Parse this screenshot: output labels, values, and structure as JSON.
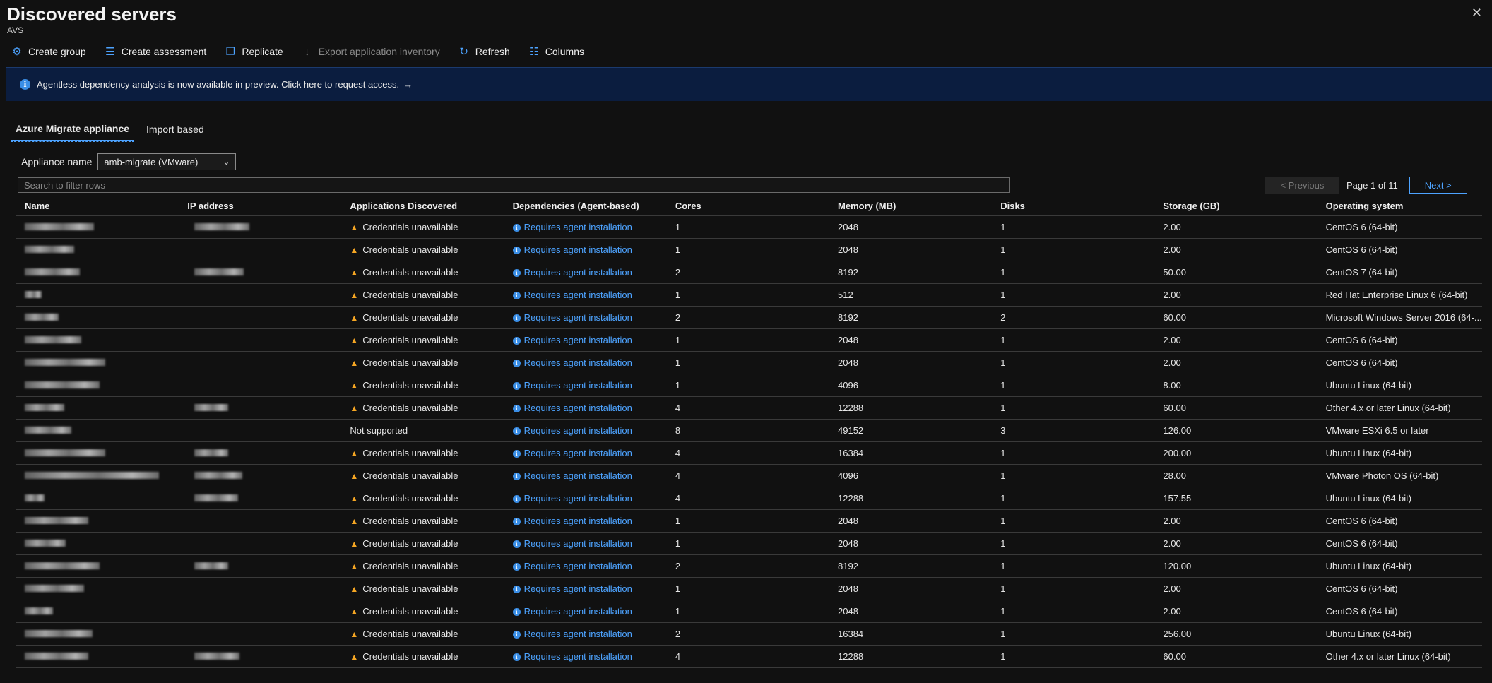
{
  "header": {
    "title": "Discovered servers",
    "subtitle": "AVS",
    "close_icon": "close-icon"
  },
  "toolbar": {
    "create_group": "Create group",
    "create_assessment": "Create assessment",
    "replicate": "Replicate",
    "export": "Export application inventory",
    "refresh": "Refresh",
    "columns": "Columns"
  },
  "banner": {
    "text": "Agentless dependency analysis is now available in preview. Click here to request access.",
    "arrow": "→"
  },
  "tabs": {
    "tab1": "Azure Migrate appliance",
    "tab2": "Import based"
  },
  "appliance": {
    "label": "Appliance name",
    "value": "amb-migrate (VMware)"
  },
  "search": {
    "placeholder": "Search to filter rows"
  },
  "pager": {
    "prev": "< Previous",
    "page": "Page 1 of 11",
    "next": "Next >"
  },
  "table": {
    "headers": [
      "Name",
      "IP address",
      "Applications Discovered",
      "Dependencies (Agent-based)",
      "Cores",
      "Memory (MB)",
      "Disks",
      "Storage (GB)",
      "Operating system"
    ],
    "rows": [
      {
        "app": "Credentials unavailable",
        "dep": "Requires agent installation",
        "cores": "1",
        "mem": "2048",
        "disks": "1",
        "storage": "2.00",
        "os": "CentOS 6 (64-bit)"
      },
      {
        "app": "Credentials unavailable",
        "dep": "Requires agent installation",
        "cores": "1",
        "mem": "2048",
        "disks": "1",
        "storage": "2.00",
        "os": "CentOS 6 (64-bit)"
      },
      {
        "app": "Credentials unavailable",
        "dep": "Requires agent installation",
        "cores": "2",
        "mem": "8192",
        "disks": "1",
        "storage": "50.00",
        "os": "CentOS 7 (64-bit)"
      },
      {
        "app": "Credentials unavailable",
        "dep": "Requires agent installation",
        "cores": "1",
        "mem": "512",
        "disks": "1",
        "storage": "2.00",
        "os": "Red Hat Enterprise Linux 6 (64-bit)"
      },
      {
        "app": "Credentials unavailable",
        "dep": "Requires agent installation",
        "cores": "2",
        "mem": "8192",
        "disks": "2",
        "storage": "60.00",
        "os": "Microsoft Windows Server 2016 (64-..."
      },
      {
        "app": "Credentials unavailable",
        "dep": "Requires agent installation",
        "cores": "1",
        "mem": "2048",
        "disks": "1",
        "storage": "2.00",
        "os": "CentOS 6 (64-bit)"
      },
      {
        "app": "Credentials unavailable",
        "dep": "Requires agent installation",
        "cores": "1",
        "mem": "2048",
        "disks": "1",
        "storage": "2.00",
        "os": "CentOS 6 (64-bit)"
      },
      {
        "app": "Credentials unavailable",
        "dep": "Requires agent installation",
        "cores": "1",
        "mem": "4096",
        "disks": "1",
        "storage": "8.00",
        "os": "Ubuntu Linux (64-bit)"
      },
      {
        "app": "Credentials unavailable",
        "dep": "Requires agent installation",
        "cores": "4",
        "mem": "12288",
        "disks": "1",
        "storage": "60.00",
        "os": "Other 4.x or later Linux (64-bit)"
      },
      {
        "app": "Not supported",
        "dep": "Requires agent installation",
        "cores": "8",
        "mem": "49152",
        "disks": "3",
        "storage": "126.00",
        "os": "VMware ESXi 6.5 or later"
      },
      {
        "app": "Credentials unavailable",
        "dep": "Requires agent installation",
        "cores": "4",
        "mem": "16384",
        "disks": "1",
        "storage": "200.00",
        "os": "Ubuntu Linux (64-bit)"
      },
      {
        "app": "Credentials unavailable",
        "dep": "Requires agent installation",
        "cores": "4",
        "mem": "4096",
        "disks": "1",
        "storage": "28.00",
        "os": "VMware Photon OS (64-bit)"
      },
      {
        "app": "Credentials unavailable",
        "dep": "Requires agent installation",
        "cores": "4",
        "mem": "12288",
        "disks": "1",
        "storage": "157.55",
        "os": "Ubuntu Linux (64-bit)"
      },
      {
        "app": "Credentials unavailable",
        "dep": "Requires agent installation",
        "cores": "1",
        "mem": "2048",
        "disks": "1",
        "storage": "2.00",
        "os": "CentOS 6 (64-bit)"
      },
      {
        "app": "Credentials unavailable",
        "dep": "Requires agent installation",
        "cores": "1",
        "mem": "2048",
        "disks": "1",
        "storage": "2.00",
        "os": "CentOS 6 (64-bit)"
      },
      {
        "app": "Credentials unavailable",
        "dep": "Requires agent installation",
        "cores": "2",
        "mem": "8192",
        "disks": "1",
        "storage": "120.00",
        "os": "Ubuntu Linux (64-bit)"
      },
      {
        "app": "Credentials unavailable",
        "dep": "Requires agent installation",
        "cores": "1",
        "mem": "2048",
        "disks": "1",
        "storage": "2.00",
        "os": "CentOS 6 (64-bit)"
      },
      {
        "app": "Credentials unavailable",
        "dep": "Requires agent installation",
        "cores": "1",
        "mem": "2048",
        "disks": "1",
        "storage": "2.00",
        "os": "CentOS 6 (64-bit)"
      },
      {
        "app": "Credentials unavailable",
        "dep": "Requires agent installation",
        "cores": "2",
        "mem": "16384",
        "disks": "1",
        "storage": "256.00",
        "os": "Ubuntu Linux (64-bit)"
      },
      {
        "app": "Credentials unavailable",
        "dep": "Requires agent installation",
        "cores": "4",
        "mem": "12288",
        "disks": "1",
        "storage": "60.00",
        "os": "Other 4.x or later Linux (64-bit)"
      }
    ]
  }
}
